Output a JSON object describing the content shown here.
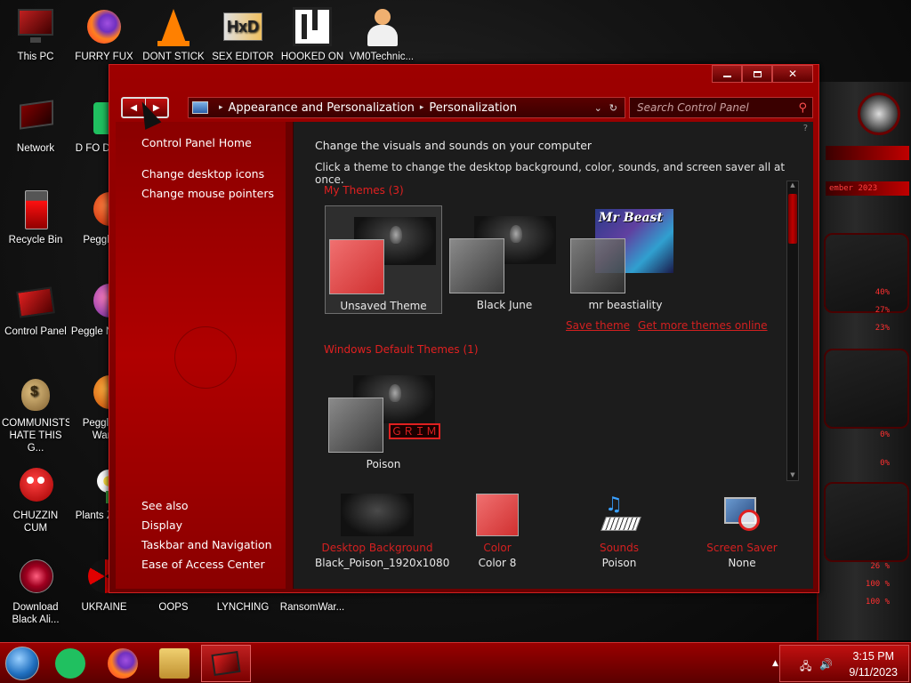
{
  "desktop": {
    "icons": [
      {
        "label": "This PC"
      },
      {
        "label": "FURRY FUX"
      },
      {
        "label": "DONT STICK"
      },
      {
        "label": "SEX EDITOR"
      },
      {
        "label": "HOOKED ON"
      },
      {
        "label": "VM0Technic..."
      },
      {
        "label": "Network"
      },
      {
        "label": "D FO DUMB"
      },
      {
        "label": "Recycle Bin"
      },
      {
        "label": "Peggle D"
      },
      {
        "label": "Control Panel"
      },
      {
        "label": "Peggle N Delu"
      },
      {
        "label": "COMMUNISTS HATE THIS G..."
      },
      {
        "label": "Peggle of Warc"
      },
      {
        "label": "CHUZZIN CUM"
      },
      {
        "label": "Plants Zomb"
      },
      {
        "label": "Download Black Ali..."
      },
      {
        "label": "UKRAINE"
      },
      {
        "label": "OOPS"
      },
      {
        "label": "LYNCHING"
      },
      {
        "label": "RansomWar..."
      }
    ]
  },
  "deco": {
    "bar1": "ember 2023",
    "pcts": [
      "40%",
      "27%",
      "23%",
      "0%",
      "0%",
      "26 %",
      "100 %",
      "100 %"
    ]
  },
  "window": {
    "nav": {
      "back": "◀",
      "forward": "▶"
    },
    "address": {
      "crumb1": "Appearance and Personalization",
      "crumb2": "Personalization"
    },
    "search": {
      "placeholder": "Search Control Panel"
    },
    "sidebar": {
      "home": "Control Panel Home",
      "links": [
        "Change desktop icons",
        "Change mouse pointers"
      ],
      "see_also_header": "See also",
      "see_also": [
        "Display",
        "Taskbar and Navigation",
        "Ease of Access Center"
      ]
    },
    "content": {
      "heading": "Change the visuals and sounds on your computer",
      "subheading": "Click a theme to change the desktop background, color, sounds, and screen saver all at once.",
      "my_themes_label": "My Themes (3)",
      "my_themes": [
        {
          "name": "Unsaved Theme",
          "swatch": "#e05050"
        },
        {
          "name": "Black June",
          "swatch": "#6a6a6a"
        },
        {
          "name": "mr beastiality",
          "swatch": "#6a6a6a"
        }
      ],
      "mrbeast_logo": "Mr Beast",
      "save_theme": "Save theme",
      "get_more": "Get more themes online",
      "default_themes_label": "Windows Default Themes (1)",
      "default_themes": [
        {
          "name": "Poison",
          "swatch": "#6a6a6a"
        }
      ],
      "grim_text": "ＧＲＩＭ",
      "bottom": [
        {
          "title": "Desktop Background",
          "value": "Black_Poison_1920x1080"
        },
        {
          "title": "Color",
          "value": "Color 8"
        },
        {
          "title": "Sounds",
          "value": "Poison"
        },
        {
          "title": "Screen Saver",
          "value": "None"
        }
      ]
    }
  },
  "taskbar": {
    "time": "3:15 PM",
    "date": "9/11/2023"
  },
  "colors": {
    "accent": "#b00000",
    "link_red": "#d42020"
  }
}
